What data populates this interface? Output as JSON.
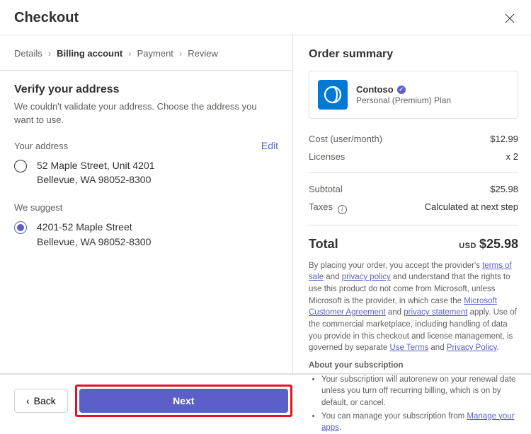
{
  "header": {
    "title": "Checkout"
  },
  "breadcrumb": {
    "items": [
      "Details",
      "Billing account",
      "Payment",
      "Review"
    ],
    "current_index": 1
  },
  "verify": {
    "heading": "Verify your address",
    "subtext": "We couldn't validate your address. Choose the address you want to use."
  },
  "your_address": {
    "label": "Your address",
    "edit_label": "Edit",
    "line1": "52 Maple Street, Unit 4201",
    "line2": "Bellevue, WA 98052-8300",
    "selected": false
  },
  "suggested": {
    "label": "We suggest",
    "line1": "4201-52 Maple Street",
    "line2": "Bellevue, WA 98052-8300",
    "selected": true
  },
  "summary": {
    "heading": "Order summary",
    "product_name": "Contoso",
    "plan": "Personal (Premium) Plan",
    "cost_label": "Cost  (user/month)",
    "cost_value": "$12.99",
    "licenses_label": "Licenses",
    "licenses_value": "x 2",
    "subtotal_label": "Subtotal",
    "subtotal_value": "$25.98",
    "taxes_label": "Taxes",
    "taxes_value": "Calculated at next step",
    "total_label": "Total",
    "total_currency": "USD",
    "total_value": "$25.98"
  },
  "legal": {
    "p1_a": "By placing your order, you accept the provider's ",
    "terms_of_sale": "terms of sale",
    "p1_b": " and ",
    "privacy_policy": "privacy policy",
    "p1_c": " and understand that the rights to use this product do not come from Microsoft, unless Microsoft is the provider, in which case the ",
    "mca": "Microsoft Customer Agreement",
    "p1_d": " and ",
    "privacy_statement": "privacy statement",
    "p1_e": " apply. Use of the commercial marketplace, including handling of data you provide in this checkout and license management, is governed by separate ",
    "use_terms": "Use Terms",
    "p1_f": " and ",
    "privacy_policy2": "Privacy Policy",
    "p1_g": ".",
    "about_heading": "About your subscription",
    "bullet1": "Your subscription will autorenew on your renewal date unless you turn off recurring billing, which is on by default, or cancel.",
    "bullet2_a": "You can manage your subscription from ",
    "manage_link": "Manage your apps",
    "bullet2_b": "."
  },
  "footer": {
    "back_label": "Back",
    "next_label": "Next"
  }
}
